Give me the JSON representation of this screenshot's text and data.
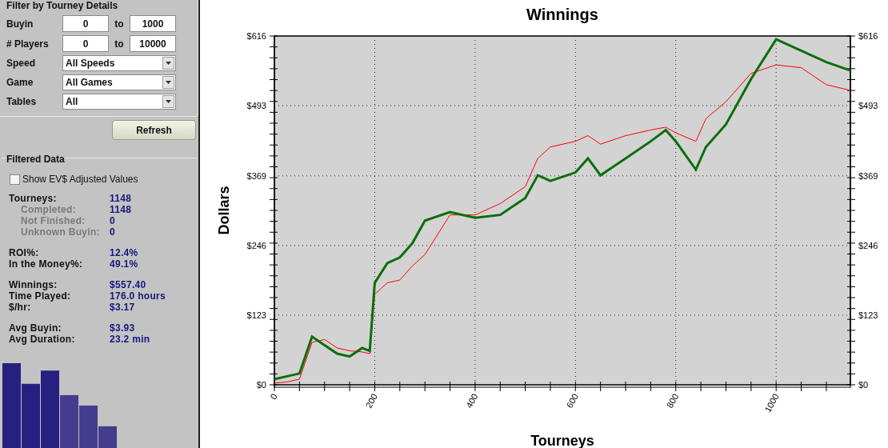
{
  "filter": {
    "title": "Filter by Tourney Details",
    "ranges": [
      {
        "label": "Buyin",
        "from": "0",
        "to_label": "to",
        "to": "1000"
      },
      {
        "label": "# Players",
        "from": "0",
        "to_label": "to",
        "to": "10000"
      }
    ],
    "dropdowns": [
      {
        "label": "Speed",
        "value": "All Speeds"
      },
      {
        "label": "Game",
        "value": "All Games"
      },
      {
        "label": "Tables",
        "value": "All"
      }
    ],
    "refresh_button": "Refresh"
  },
  "filtered": {
    "title": "Filtered Data",
    "checkbox": {
      "label": "Show EV$ Adjusted Values",
      "checked": false
    },
    "groups": [
      [
        {
          "kind": "main",
          "label": "Tourneys:",
          "value": "1148"
        },
        {
          "kind": "sub",
          "label": "Completed:",
          "value": "1148"
        },
        {
          "kind": "sub",
          "label": "Not Finished:",
          "value": "0"
        },
        {
          "kind": "sub",
          "label": "Unknown Buyin:",
          "value": "0"
        }
      ],
      [
        {
          "kind": "main",
          "label": "ROI%:",
          "value": "12.4%"
        },
        {
          "kind": "main",
          "label": "In the Money%:",
          "value": "49.1%"
        }
      ],
      [
        {
          "kind": "main",
          "label": "Winnings:",
          "value": "$557.40"
        },
        {
          "kind": "main",
          "label": "Time Played:",
          "value": "176.0 hours"
        },
        {
          "kind": "main",
          "label": "$/hr:",
          "value": "$3.17"
        }
      ],
      [
        {
          "kind": "main",
          "label": "Avg Buyin:",
          "value": "$3.93"
        },
        {
          "kind": "main",
          "label": "Avg Duration:",
          "value": "23.2 min"
        }
      ]
    ]
  },
  "chart": {
    "chart_data": {
      "type": "line",
      "title": "Winnings",
      "xlabel": "Tourneys",
      "ylabel": "Dollars",
      "x": [
        0,
        25,
        50,
        75,
        100,
        125,
        150,
        175,
        190,
        200,
        225,
        250,
        275,
        300,
        350,
        400,
        450,
        500,
        525,
        550,
        600,
        625,
        650,
        700,
        750,
        780,
        800,
        840,
        860,
        900,
        950,
        1000,
        1050,
        1100,
        1148
      ],
      "series": [
        {
          "color": "#0b6e0b",
          "values": [
            10,
            15,
            20,
            85,
            70,
            55,
            50,
            65,
            60,
            180,
            215,
            225,
            250,
            290,
            305,
            295,
            300,
            330,
            370,
            360,
            375,
            400,
            370,
            400,
            430,
            450,
            430,
            380,
            420,
            460,
            540,
            610,
            590,
            570,
            555
          ]
        },
        {
          "color": "#ff0000",
          "values": [
            3,
            5,
            10,
            75,
            80,
            65,
            60,
            58,
            55,
            160,
            180,
            185,
            210,
            230,
            300,
            300,
            320,
            350,
            400,
            420,
            430,
            440,
            425,
            440,
            450,
            455,
            445,
            430,
            470,
            500,
            550,
            565,
            560,
            530,
            520
          ]
        }
      ],
      "grid": true,
      "xlim": [
        0,
        1148
      ],
      "ylim": [
        0,
        616
      ],
      "xticks": [
        0,
        200,
        400,
        600,
        800,
        1000
      ],
      "yticks": [
        {
          "value": 0,
          "label": "$0"
        },
        {
          "value": 123,
          "label": "$123"
        },
        {
          "value": 246,
          "label": "$246"
        },
        {
          "value": 369,
          "label": "$369"
        },
        {
          "value": 493,
          "label": "$493"
        },
        {
          "value": 616,
          "label": "$616"
        }
      ]
    }
  }
}
